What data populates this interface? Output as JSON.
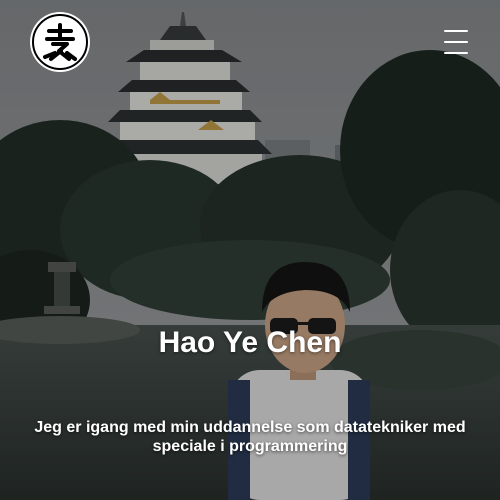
{
  "header": {
    "logo_icon": "seal-logo-icon",
    "menu_icon": "hamburger-menu-icon"
  },
  "hero": {
    "name": "Hao Ye Chen",
    "tagline": "Jeg er igang med min uddannelse som datatekniker med speciale i programmering"
  },
  "colors": {
    "text": "#ffffff",
    "logo_background": "#ffffff",
    "logo_mark": "#000000"
  }
}
